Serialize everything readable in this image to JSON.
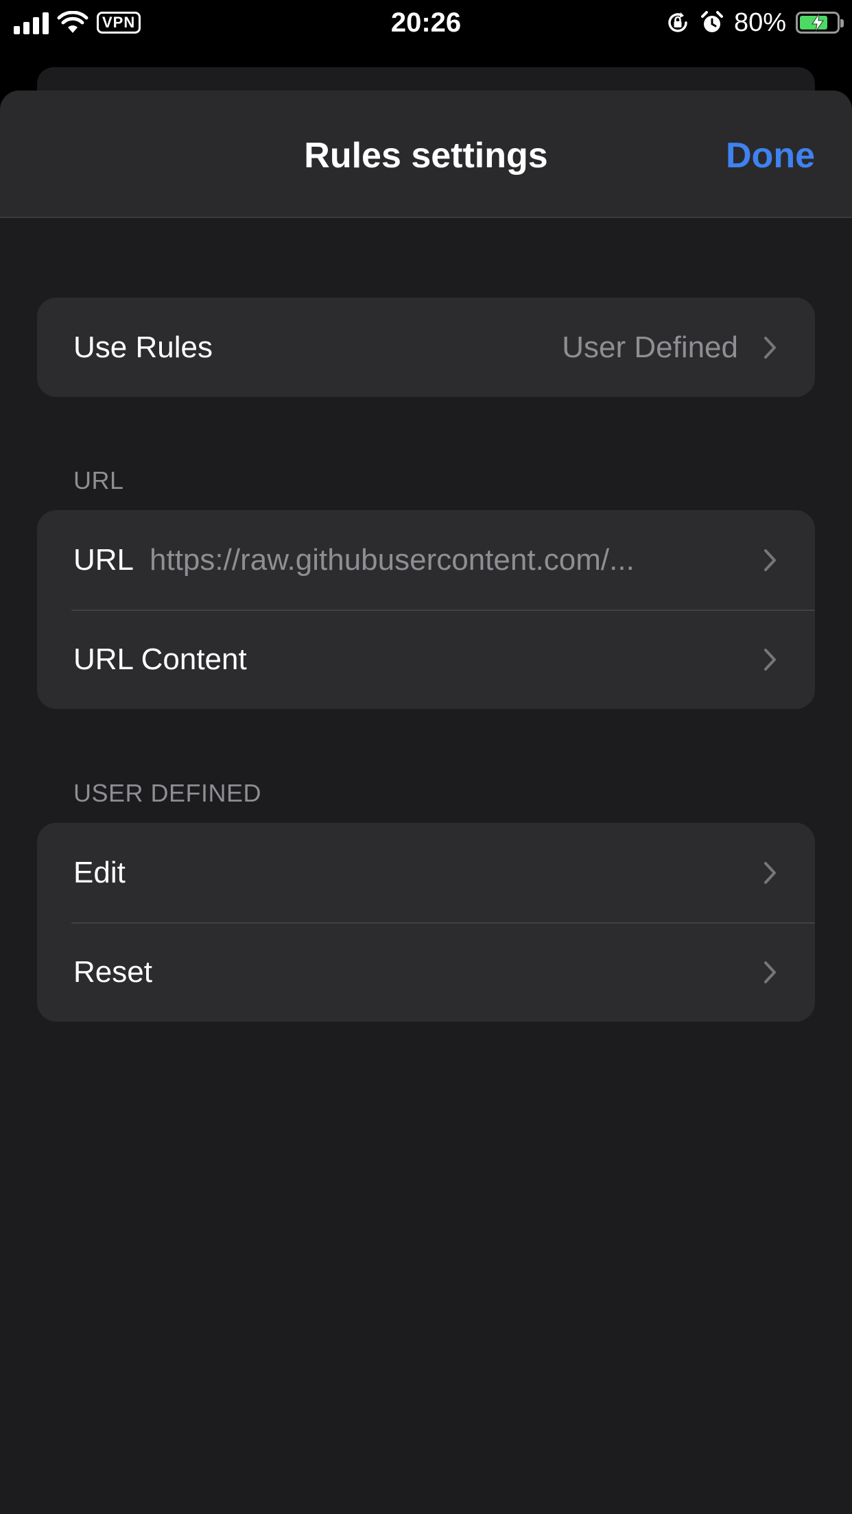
{
  "status_bar": {
    "time": "20:26",
    "vpn_label": "VPN",
    "battery_percent": "80%",
    "battery_level": 0.8,
    "icons": [
      "signal-icon",
      "wifi-icon",
      "orientation-lock-icon",
      "alarm-icon",
      "battery-charging-icon"
    ]
  },
  "nav": {
    "title": "Rules settings",
    "done_label": "Done"
  },
  "use_rules": {
    "label": "Use Rules",
    "value": "User Defined"
  },
  "url_section": {
    "header": "URL",
    "rows": [
      {
        "label": "URL",
        "value": "https://raw.githubusercontent.com/..."
      },
      {
        "label": "URL Content"
      }
    ]
  },
  "user_defined_section": {
    "header": "USER DEFINED",
    "rows": [
      {
        "label": "Edit"
      },
      {
        "label": "Reset"
      }
    ]
  },
  "colors": {
    "accent": "#3f82f0",
    "background": "#1c1c1e",
    "cell": "#2c2c2e",
    "secondary_text": "#8e8e93",
    "battery": "#4cd964"
  }
}
